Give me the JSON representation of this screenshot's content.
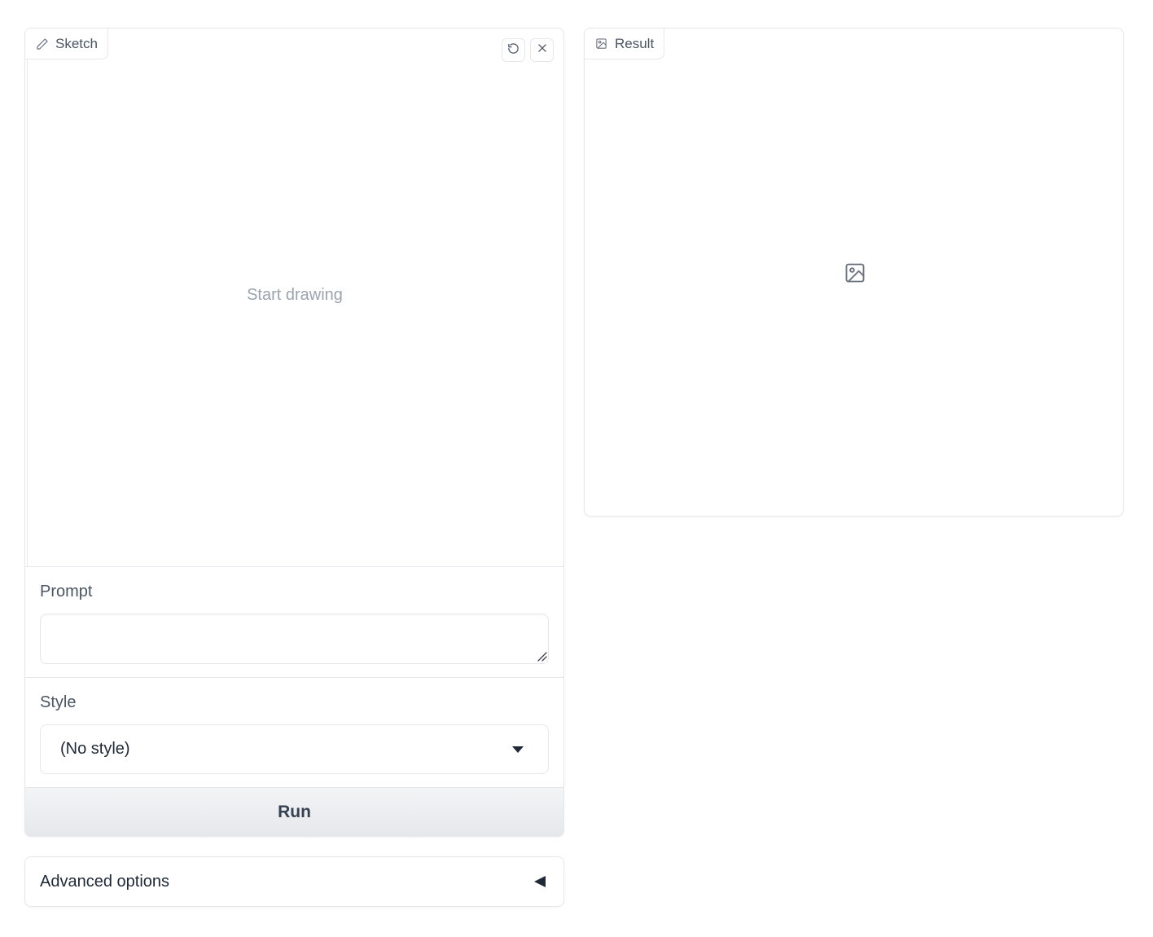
{
  "sketch": {
    "label": "Sketch",
    "label_icon": "pencil-icon",
    "placeholder": "Start drawing",
    "undo_icon": "undo-icon",
    "clear_icon": "close-icon"
  },
  "prompt": {
    "label": "Prompt",
    "value": "",
    "placeholder": ""
  },
  "style": {
    "label": "Style",
    "selected": "(No style)"
  },
  "run_button": {
    "label": "Run"
  },
  "advanced": {
    "label": "Advanced options",
    "state_icon": "caret-left-icon"
  },
  "result": {
    "label": "Result",
    "label_icon": "image-icon",
    "empty_icon": "image-icon"
  }
}
